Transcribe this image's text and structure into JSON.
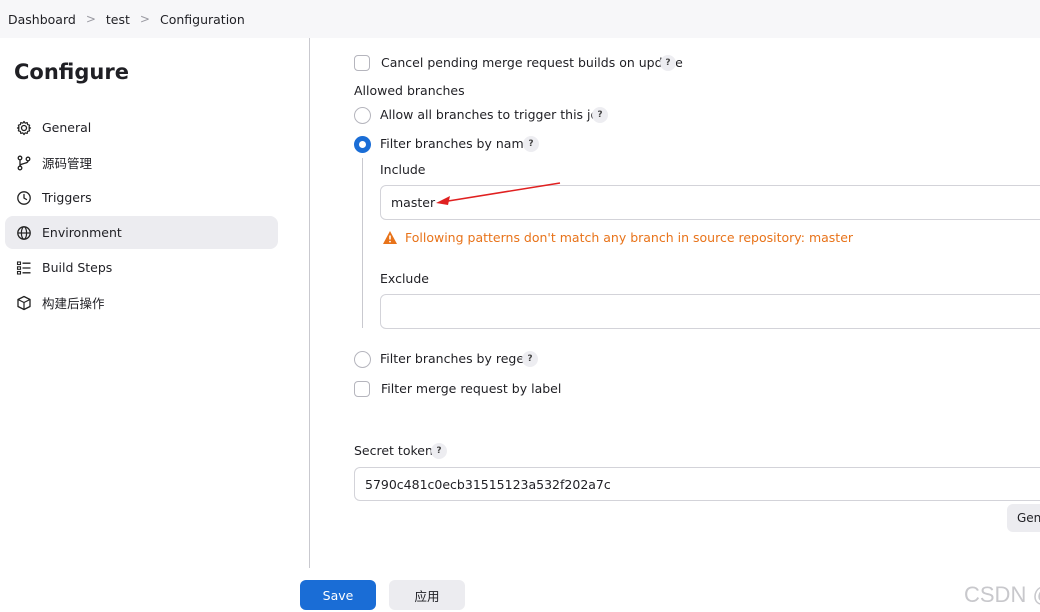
{
  "breadcrumb": {
    "items": [
      "Dashboard",
      "test",
      "Configuration"
    ],
    "separator": ">"
  },
  "sidebar": {
    "title": "Configure",
    "items": [
      {
        "label": "General",
        "icon": "gear-icon"
      },
      {
        "label": "源码管理",
        "icon": "branch-icon"
      },
      {
        "label": "Triggers",
        "icon": "clock-icon"
      },
      {
        "label": "Environment",
        "icon": "globe-icon",
        "active": true
      },
      {
        "label": "Build Steps",
        "icon": "list-icon"
      },
      {
        "label": "构建后操作",
        "icon": "cube-icon"
      }
    ]
  },
  "main": {
    "cancel_pending_label": "Cancel pending merge request builds on update",
    "help_glyph": "?",
    "allowed_branches_label": "Allowed branches",
    "allow_all_label": "Allow all branches to trigger this job",
    "filter_by_name_label": "Filter branches by name",
    "include_label": "Include",
    "include_value": "master",
    "warning_text": "Following patterns don't match any branch in source repository: master",
    "exclude_label": "Exclude",
    "exclude_value": "",
    "filter_by_regex_label": "Filter branches by regex",
    "filter_merge_label": "Filter merge request by label",
    "secret_token_label": "Secret token",
    "secret_token_value": "5790c481c0ecb31515123a532f202a7c",
    "generate_button_label": "Gen"
  },
  "footer": {
    "save_label": "Save",
    "apply_label": "应用"
  },
  "watermark": "CSDN @",
  "colors": {
    "accent": "#1a6dd6",
    "warning": "#e8731a",
    "annotation_arrow": "#e02020"
  }
}
